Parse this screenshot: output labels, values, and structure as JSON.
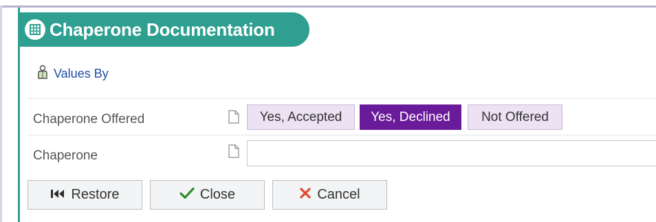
{
  "header": {
    "title": "Chaperone Documentation",
    "icon": "grid-table-icon",
    "accent_color": "#2f9f91"
  },
  "values_by": {
    "label": "Values By",
    "icon": "person-icon"
  },
  "fields": {
    "chaperone_offered": {
      "label": "Chaperone Offered",
      "icon": "document-icon",
      "options": [
        "Yes, Accepted",
        "Yes, Declined",
        "Not Offered"
      ],
      "selected": "Yes, Declined",
      "selected_color": "#6a1b9a"
    },
    "chaperone": {
      "label": "Chaperone",
      "icon": "document-icon",
      "value": ""
    }
  },
  "buttons": {
    "restore": {
      "label": "Restore",
      "icon": "skip-back-icon"
    },
    "close": {
      "label": "Close",
      "icon": "checkmark-icon",
      "icon_color": "#2e8b2e"
    },
    "cancel": {
      "label": "Cancel",
      "icon": "x-icon",
      "icon_color": "#e04a2c"
    }
  }
}
